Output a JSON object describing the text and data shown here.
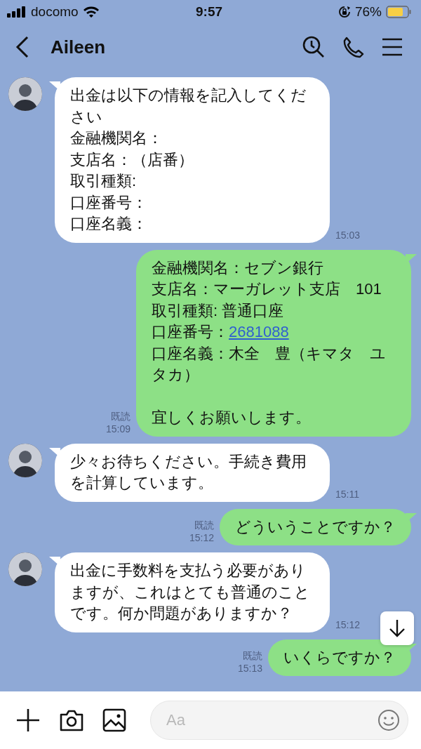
{
  "status_bar": {
    "carrier": "docomo",
    "time": "9:57",
    "battery": "76%"
  },
  "header": {
    "title": "Aileen"
  },
  "messages": [
    {
      "kind": "incoming",
      "lines": [
        {
          "text": "出金は以下の情報を記入してください"
        },
        {
          "text": "金融機関名："
        },
        {
          "text": "支店名：（店番）"
        },
        {
          "text": "取引種類:"
        },
        {
          "text": "口座番号："
        },
        {
          "text": "口座名義："
        }
      ],
      "time": "15:03"
    },
    {
      "kind": "outgoing",
      "lines": [
        {
          "text": "金融機関名：セブン銀行"
        },
        {
          "text": "支店名：マーガレット支店　101"
        },
        {
          "text": "取引種類: 普通口座"
        },
        {
          "text": "口座番号：",
          "link": "2681088"
        },
        {
          "text": "口座名義：木全　豊（キマタ　ユタカ）"
        },
        {
          "text": "宜しくお願いします。",
          "blank_line_before": true
        }
      ],
      "read_label": "既読",
      "time": "15:09"
    },
    {
      "kind": "incoming",
      "lines": [
        {
          "text": "少々お待ちください。手続き費用を計算しています。"
        }
      ],
      "time": "15:11"
    },
    {
      "kind": "outgoing",
      "lines": [
        {
          "text": "どういうことですか？"
        }
      ],
      "read_label": "既読",
      "time": "15:12"
    },
    {
      "kind": "incoming",
      "lines": [
        {
          "text": "出金に手数料を支払う必要がありますが、これはとても普通のことです。何か問題がありますか？"
        }
      ],
      "time": "15:12"
    },
    {
      "kind": "outgoing",
      "lines": [
        {
          "text": "いくらですか？"
        }
      ],
      "read_label": "既読",
      "time": "15:13"
    }
  ],
  "input_bar": {
    "placeholder": "Aa"
  }
}
